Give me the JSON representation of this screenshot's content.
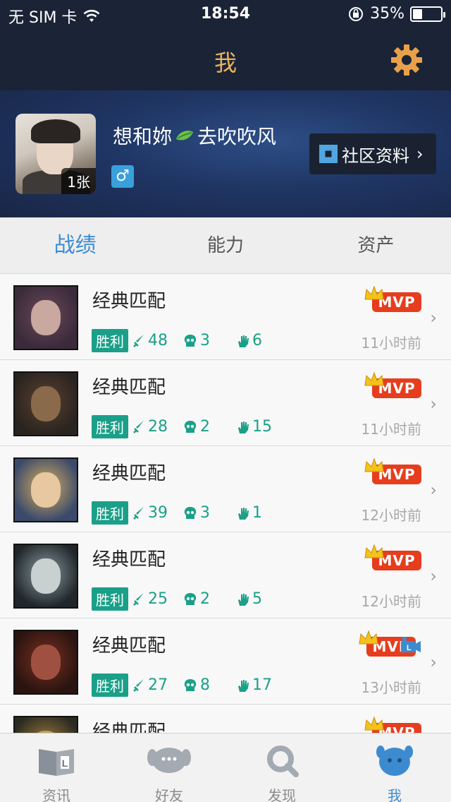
{
  "status_bar": {
    "carrier": "无 SIM 卡",
    "time": "18:54",
    "battery_percent": "35%",
    "battery_level": 0.35
  },
  "nav": {
    "title": "我",
    "settings_icon": "gear-icon",
    "title_color": "#e8b45e"
  },
  "profile": {
    "nickname_part1": "想和妳",
    "nickname_part2": "去吹吹风",
    "nickname_emoji": "leaf-icon",
    "photo_count": "1张",
    "gender_symbol": "♂",
    "community_label": "社区资料"
  },
  "tabs": [
    {
      "label": "战绩",
      "active": true
    },
    {
      "label": "能力",
      "active": false
    },
    {
      "label": "资产",
      "active": false
    }
  ],
  "matches": [
    {
      "type": "经典匹配",
      "result": "胜利",
      "kills": "48",
      "deaths": "3",
      "assists": "6",
      "time": "11小时前",
      "mvp": "MVP",
      "video": false
    },
    {
      "type": "经典匹配",
      "result": "胜利",
      "kills": "28",
      "deaths": "2",
      "assists": "15",
      "time": "11小时前",
      "mvp": "MVP",
      "video": false
    },
    {
      "type": "经典匹配",
      "result": "胜利",
      "kills": "39",
      "deaths": "3",
      "assists": "1",
      "time": "12小时前",
      "mvp": "MVP",
      "video": false
    },
    {
      "type": "经典匹配",
      "result": "胜利",
      "kills": "25",
      "deaths": "2",
      "assists": "5",
      "time": "12小时前",
      "mvp": "MVP",
      "video": false
    },
    {
      "type": "经典匹配",
      "result": "胜利",
      "kills": "27",
      "deaths": "8",
      "assists": "17",
      "time": "13小时前",
      "mvp": "MVP",
      "video": true
    },
    {
      "type": "经典匹配",
      "result": "",
      "kills": "",
      "deaths": "",
      "assists": "",
      "time": "",
      "mvp": "MVP",
      "video": false
    }
  ],
  "bottom_tabs": [
    {
      "label": "资讯",
      "icon": "book-icon",
      "active": false
    },
    {
      "label": "好友",
      "icon": "friends-icon",
      "active": false
    },
    {
      "label": "发现",
      "icon": "discover-icon",
      "active": false
    },
    {
      "label": "我",
      "icon": "me-icon",
      "active": true
    }
  ],
  "colors": {
    "accent_green": "#1aa088",
    "accent_blue": "#3c8bd1",
    "mvp_red": "#e63d1e",
    "dark_header": "#1b2336"
  }
}
